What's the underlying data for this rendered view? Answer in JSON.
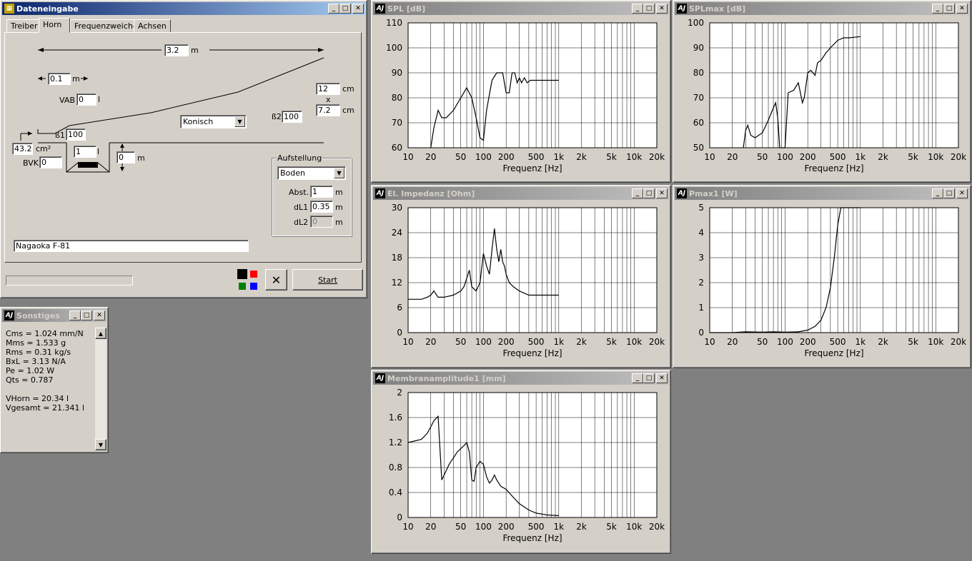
{
  "dateneingabe": {
    "title": "Dateneingabe",
    "tabs": [
      "Treiber",
      "Horn",
      "Frequenzweiche",
      "Achsen"
    ],
    "length_value": "3.2",
    "length_unit": "m",
    "offset_value": "0.1",
    "offset_unit": "m",
    "vab_label": "VAB",
    "vab_value": "0",
    "vab_unit": "l",
    "mouth_w": "12",
    "mouth_h": "7.2",
    "mouth_unit": "cm",
    "times": "x",
    "beta2_label": "ß2",
    "beta2_value": "100",
    "horn_type": "Konisch",
    "beta1_label": "ß1",
    "beta1_value": "100",
    "throat_value": "43.2",
    "throat_unit": "cm²",
    "bvk_label": "BVK",
    "bvk_value": "0",
    "chamber_value": "1",
    "chamber_unit": "l",
    "depth_value": "0",
    "depth_unit": "m",
    "aufstellung_label": "Aufstellung",
    "aufstellung_value": "Boden",
    "abst_label": "Abst.",
    "abst_value": "1",
    "abst_unit": "m",
    "dl1_label": "dL1",
    "dl1_value": "0.35",
    "dl1_unit": "m",
    "dl2_label": "dL2",
    "dl2_value": "0",
    "dl2_unit": "m",
    "driver_name": "Nagaoka F-81",
    "start_label": "Start",
    "colors": {
      "black": "#000000",
      "red": "#ff0000",
      "green": "#008000",
      "blue": "#0000ff"
    }
  },
  "sonstiges": {
    "title": "Sonstiges",
    "lines": [
      "Cms = 1.024 mm/N",
      "Mms = 1.533 g",
      "Rms = 0.31 kg/s",
      "BxL = 3.13 N/A",
      "Pe = 1.02 W",
      "Qts = 0.787",
      "",
      "VHorn = 20.34 l",
      "Vgesamt = 21.341 l"
    ]
  },
  "chart_data": [
    {
      "type": "line",
      "title": "SPL [dB]",
      "xlabel": "Frequenz [Hz]",
      "xscale": "log",
      "xticks": [
        "10",
        "20",
        "50",
        "100",
        "200",
        "500",
        "1k",
        "2k",
        "5k",
        "10k",
        "20k"
      ],
      "yticks": [
        "110",
        "100",
        "90",
        "80",
        "70",
        "60"
      ],
      "ylim": [
        60,
        110
      ],
      "xlim": [
        10,
        20000
      ],
      "x": [
        20,
        22,
        25,
        28,
        32,
        40,
        50,
        60,
        70,
        80,
        90,
        100,
        110,
        130,
        150,
        180,
        200,
        220,
        240,
        260,
        280,
        300,
        320,
        350,
        380,
        420,
        500,
        700,
        1000
      ],
      "y": [
        60,
        68,
        75,
        72,
        72,
        75,
        80,
        84,
        80,
        72,
        64,
        63,
        75,
        87,
        90,
        90,
        82,
        82,
        90,
        90,
        86,
        88,
        86,
        88,
        86,
        87,
        87,
        87,
        87
      ]
    },
    {
      "type": "line",
      "title": "SPLmax [dB]",
      "xlabel": "Frequenz [Hz]",
      "xscale": "log",
      "xticks": [
        "10",
        "20",
        "50",
        "100",
        "200",
        "500",
        "1k",
        "2k",
        "5k",
        "10k",
        "20k"
      ],
      "yticks": [
        "100",
        "90",
        "80",
        "70",
        "60",
        "50"
      ],
      "ylim": [
        50,
        100
      ],
      "xlim": [
        10,
        20000
      ],
      "x": [
        28,
        30,
        32,
        35,
        40,
        50,
        60,
        70,
        75,
        80,
        85,
        95,
        100,
        110,
        130,
        150,
        160,
        170,
        180,
        200,
        220,
        250,
        270,
        300,
        350,
        400,
        500,
        600,
        700,
        1000
      ],
      "y": [
        50,
        57,
        59,
        55,
        54,
        56,
        61,
        66,
        68,
        62,
        50,
        50,
        50,
        72,
        73,
        76,
        72,
        68,
        70,
        80,
        81,
        79,
        84,
        85,
        88,
        90,
        93,
        94,
        94,
        94.5
      ]
    },
    {
      "type": "line",
      "title": "El. Impedanz [Ohm]",
      "xlabel": "Frequenz [Hz]",
      "xscale": "log",
      "xticks": [
        "10",
        "20",
        "50",
        "100",
        "200",
        "500",
        "1k",
        "2k",
        "5k",
        "10k",
        "20k"
      ],
      "yticks": [
        "30",
        "24",
        "18",
        "12",
        "6",
        "0"
      ],
      "ylim": [
        0,
        30
      ],
      "xlim": [
        10,
        20000
      ],
      "x": [
        10,
        15,
        18,
        20,
        22,
        25,
        30,
        40,
        50,
        55,
        60,
        65,
        70,
        80,
        90,
        100,
        110,
        120,
        130,
        140,
        150,
        160,
        170,
        180,
        190,
        200,
        220,
        250,
        300,
        400,
        500,
        700,
        1000
      ],
      "y": [
        8,
        8,
        8.5,
        9,
        10,
        8.5,
        8.5,
        9,
        10,
        11,
        13,
        15,
        11,
        10,
        12,
        19,
        16,
        14,
        20,
        25,
        20,
        17,
        20,
        17,
        16,
        14,
        12,
        11,
        10,
        9,
        9,
        9,
        9
      ]
    },
    {
      "type": "line",
      "title": "Pmax1 [W]",
      "xlabel": "Frequenz [Hz]",
      "xscale": "log",
      "xticks": [
        "10",
        "20",
        "50",
        "100",
        "200",
        "500",
        "1k",
        "2k",
        "5k",
        "10k",
        "20k"
      ],
      "yticks": [
        "5",
        "4",
        "3",
        "2",
        "1",
        "0"
      ],
      "ylim": [
        0,
        5
      ],
      "xlim": [
        10,
        20000
      ],
      "x": [
        10,
        20,
        30,
        50,
        70,
        100,
        150,
        200,
        250,
        300,
        350,
        400,
        450,
        500,
        550,
        600,
        700,
        800,
        1000
      ],
      "y": [
        0,
        0,
        0.03,
        0.02,
        0.03,
        0.02,
        0.03,
        0.1,
        0.25,
        0.5,
        1.0,
        1.8,
        3.0,
        4.3,
        5,
        5,
        5,
        5,
        5
      ]
    },
    {
      "type": "line",
      "title": "Membranamplitude1 [mm]",
      "xlabel": "Frequenz [Hz]",
      "xscale": "log",
      "xticks": [
        "10",
        "20",
        "50",
        "100",
        "200",
        "500",
        "1k",
        "2k",
        "5k",
        "10k",
        "20k"
      ],
      "yticks": [
        "2",
        "1.6",
        "1.2",
        "0.8",
        "0.4",
        "0"
      ],
      "ylim": [
        0,
        2
      ],
      "xlim": [
        10,
        20000
      ],
      "x": [
        10,
        15,
        18,
        20,
        22,
        25,
        28,
        35,
        45,
        55,
        60,
        65,
        70,
        75,
        80,
        90,
        100,
        110,
        120,
        130,
        140,
        150,
        170,
        200,
        250,
        300,
        400,
        500,
        700,
        1000
      ],
      "y": [
        1.2,
        1.25,
        1.35,
        1.45,
        1.55,
        1.62,
        0.6,
        0.85,
        1.05,
        1.15,
        1.2,
        1.05,
        0.6,
        0.58,
        0.8,
        0.9,
        0.85,
        0.65,
        0.55,
        0.6,
        0.68,
        0.6,
        0.5,
        0.45,
        0.32,
        0.22,
        0.12,
        0.07,
        0.04,
        0.03
      ]
    }
  ]
}
